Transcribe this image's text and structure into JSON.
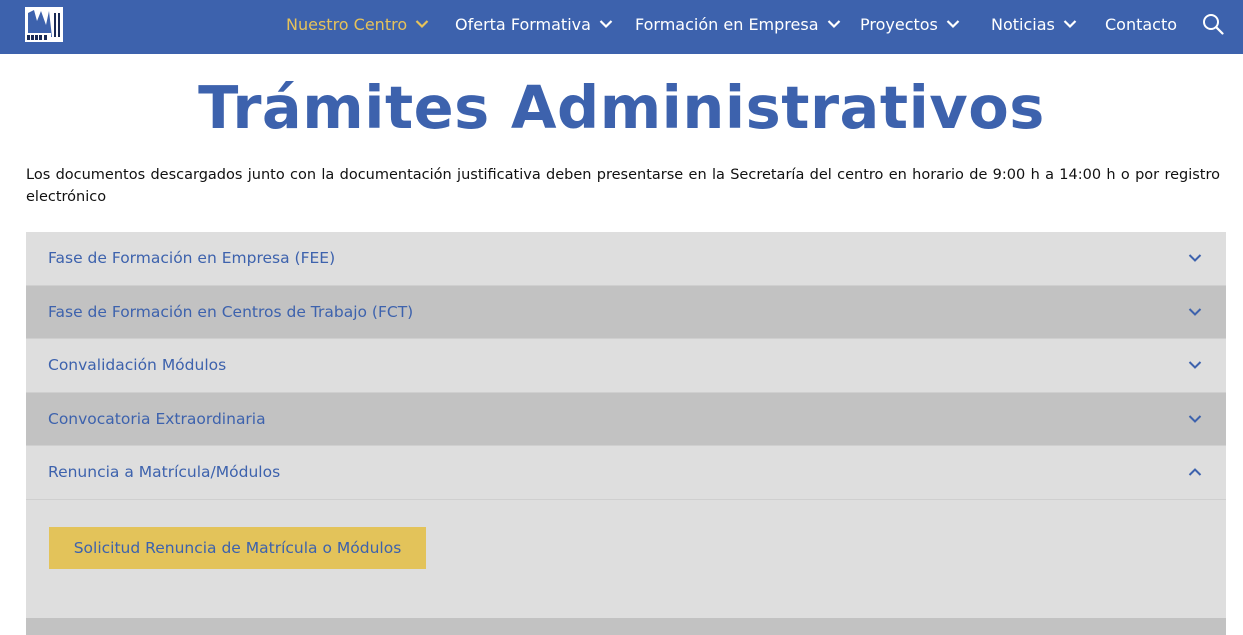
{
  "nav": {
    "logo_icon": "school-logo",
    "items": [
      {
        "label": "Nuestro Centro",
        "has_dropdown": true,
        "active": true
      },
      {
        "label": "Oferta Formativa",
        "has_dropdown": true,
        "active": false
      },
      {
        "label": "Formación en Empresa",
        "has_dropdown": true,
        "active": false
      },
      {
        "label": "Proyectos",
        "has_dropdown": true,
        "active": false
      },
      {
        "label": "Noticias",
        "has_dropdown": true,
        "active": false
      },
      {
        "label": "Contacto",
        "has_dropdown": false,
        "active": false
      }
    ],
    "search_icon": "search-icon"
  },
  "page": {
    "title": "Trámites Administrativos",
    "intro": "Los documentos descargados junto con la documentación justificativa deben presentarse en la Secretaría del centro en horario de 9:00 h a 14:00 h o por registro electrónico"
  },
  "accordion": {
    "sections": [
      {
        "title": "Fase de Formación en Empresa (FEE)",
        "expanded": false
      },
      {
        "title": "Fase de Formación en Centros de Trabajo (FCT)",
        "expanded": false
      },
      {
        "title": "Convalidación Módulos",
        "expanded": false
      },
      {
        "title": "Convocatoria Extraordinaria",
        "expanded": false
      },
      {
        "title": "Renuncia a Matrícula/Módulos",
        "expanded": true
      }
    ],
    "expanded_panel": {
      "button_label": "Solicitud Renuncia de Matrícula o Módulos"
    }
  },
  "colors": {
    "brand_blue": "#3d62ad",
    "accent_yellow": "#e3c35a",
    "active_nav": "#e6c25a",
    "row_light": "#dedede",
    "row_dark": "#c2c2c2"
  }
}
